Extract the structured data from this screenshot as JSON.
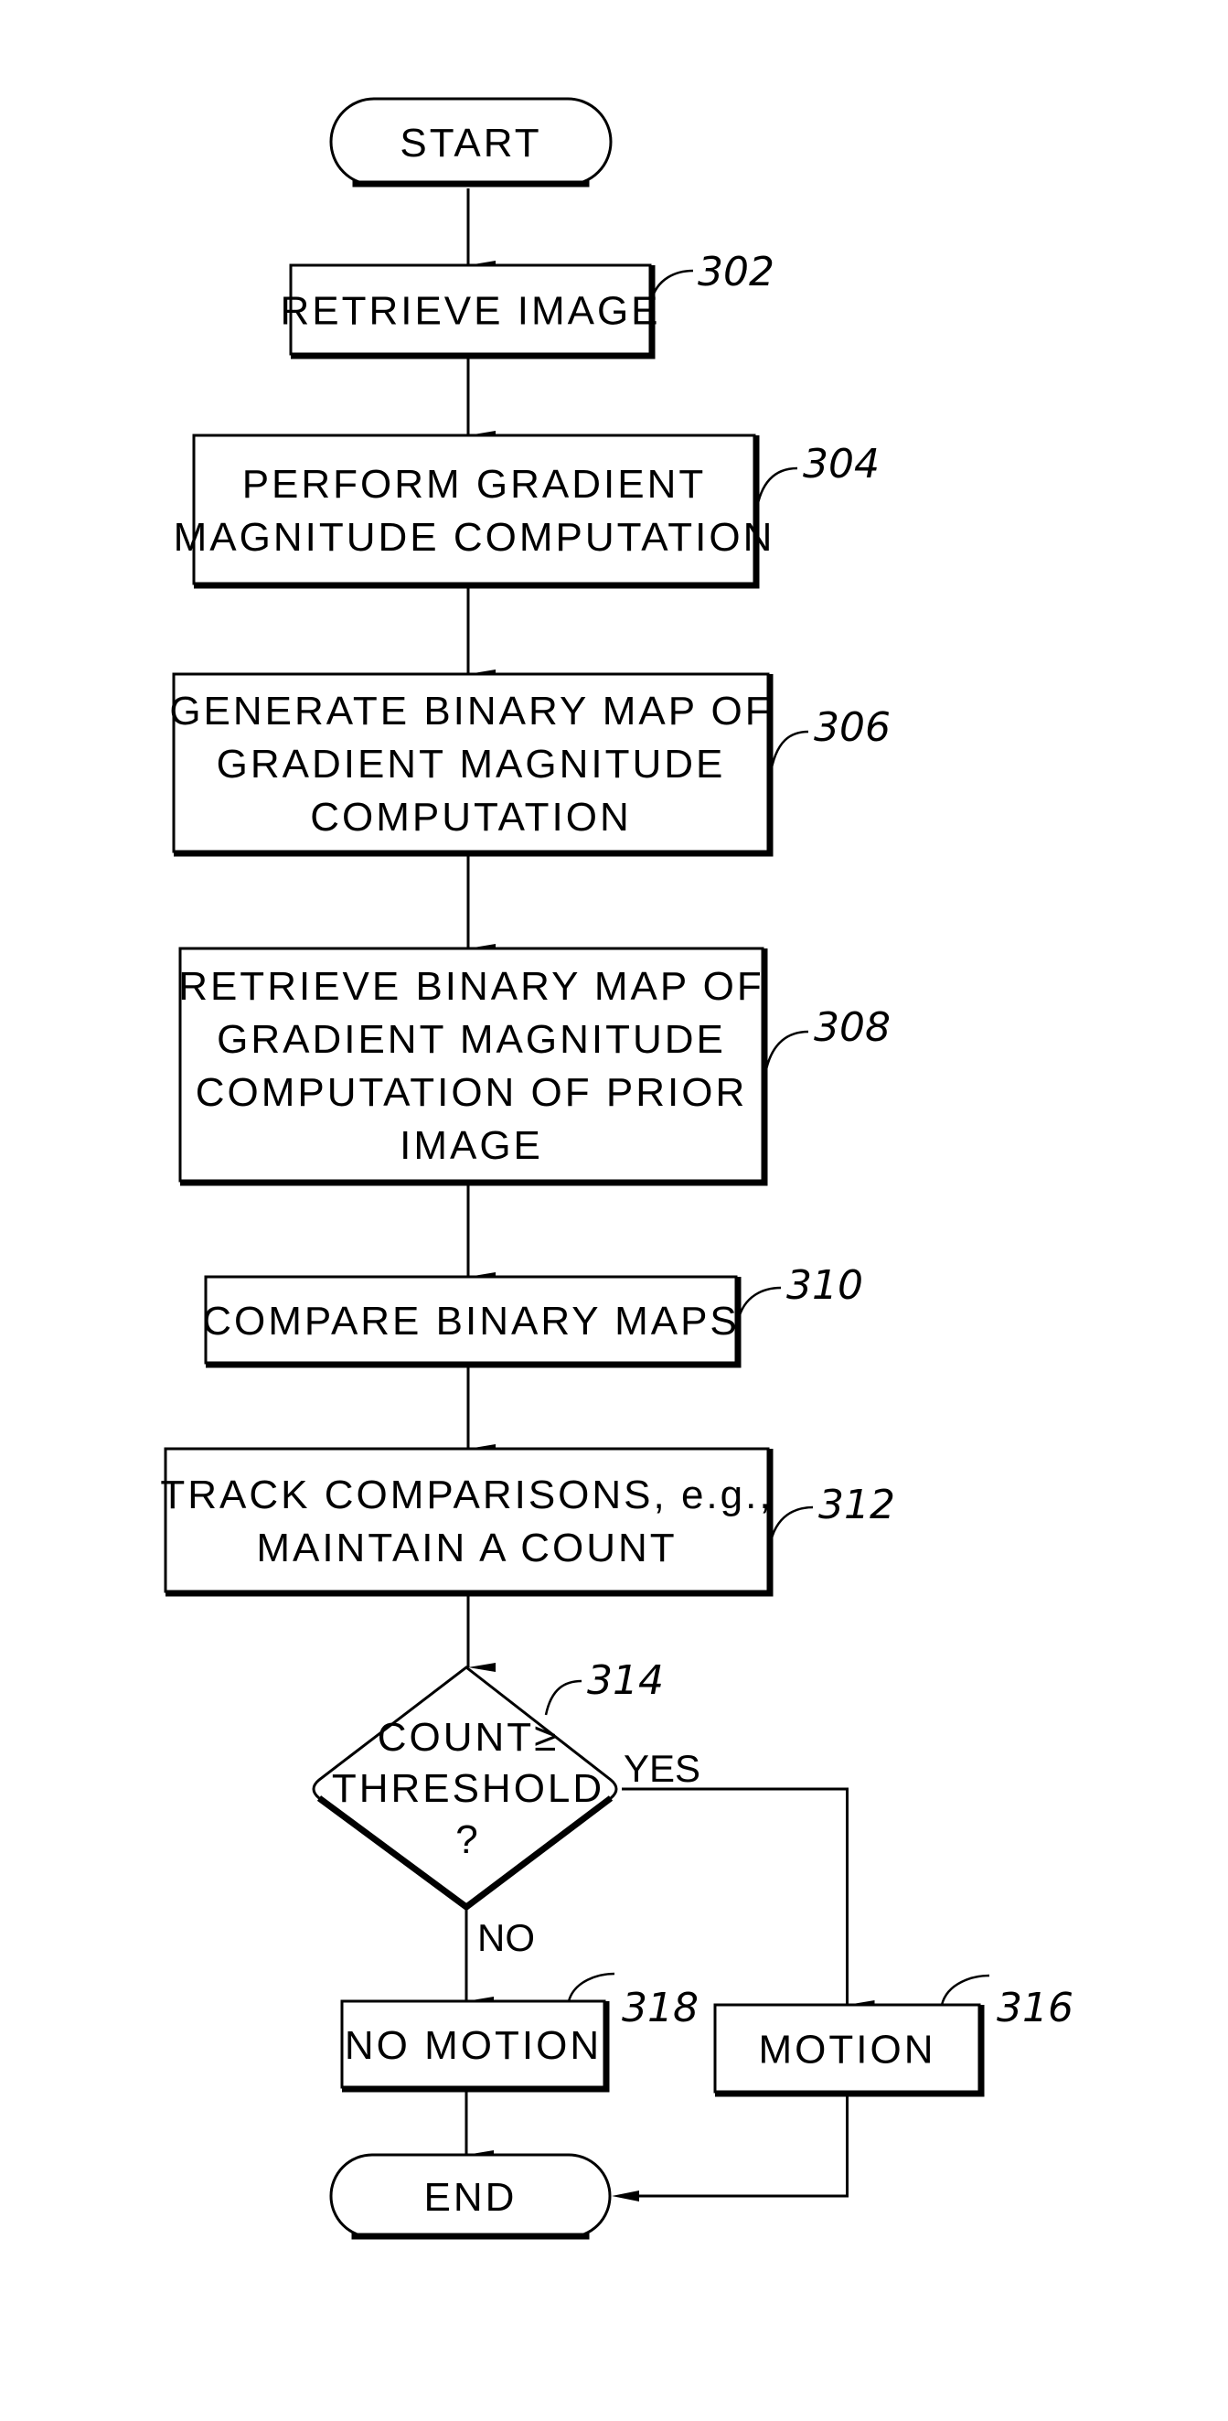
{
  "diagram": {
    "type": "flowchart",
    "nodes": [
      {
        "id": "start",
        "kind": "terminal",
        "lines": [
          "START"
        ]
      },
      {
        "id": "302",
        "kind": "process",
        "ref": "302",
        "lines": [
          "RETRIEVE IMAGE"
        ]
      },
      {
        "id": "304",
        "kind": "process",
        "ref": "304",
        "lines": [
          "PERFORM GRADIENT",
          "MAGNITUDE COMPUTATION"
        ]
      },
      {
        "id": "306",
        "kind": "process",
        "ref": "306",
        "lines": [
          "GENERATE BINARY MAP OF",
          "GRADIENT MAGNITUDE",
          "COMPUTATION"
        ]
      },
      {
        "id": "308",
        "kind": "process",
        "ref": "308",
        "lines": [
          "RETRIEVE BINARY MAP OF",
          "GRADIENT MAGNITUDE",
          "COMPUTATION OF PRIOR",
          "IMAGE"
        ]
      },
      {
        "id": "310",
        "kind": "process",
        "ref": "310",
        "lines": [
          "COMPARE BINARY MAPS"
        ]
      },
      {
        "id": "312",
        "kind": "process",
        "ref": "312",
        "lines": [
          "TRACK COMPARISONS, e.g.,",
          "MAINTAIN A COUNT"
        ]
      },
      {
        "id": "314",
        "kind": "decision",
        "ref": "314",
        "lines": [
          "COUNT≥",
          "THRESHOLD",
          "?"
        ]
      },
      {
        "id": "316",
        "kind": "process",
        "ref": "316",
        "lines": [
          "MOTION"
        ]
      },
      {
        "id": "318",
        "kind": "process",
        "ref": "318",
        "lines": [
          "NO MOTION"
        ]
      },
      {
        "id": "end",
        "kind": "terminal",
        "lines": [
          "END"
        ]
      }
    ],
    "edges": [
      {
        "from": "start",
        "to": "302",
        "label": ""
      },
      {
        "from": "302",
        "to": "304",
        "label": ""
      },
      {
        "from": "304",
        "to": "306",
        "label": ""
      },
      {
        "from": "306",
        "to": "308",
        "label": ""
      },
      {
        "from": "308",
        "to": "310",
        "label": ""
      },
      {
        "from": "310",
        "to": "312",
        "label": ""
      },
      {
        "from": "312",
        "to": "314",
        "label": ""
      },
      {
        "from": "314",
        "to": "316",
        "label": "YES"
      },
      {
        "from": "314",
        "to": "318",
        "label": "NO"
      },
      {
        "from": "318",
        "to": "end",
        "label": ""
      },
      {
        "from": "316",
        "to": "end",
        "label": ""
      }
    ]
  }
}
